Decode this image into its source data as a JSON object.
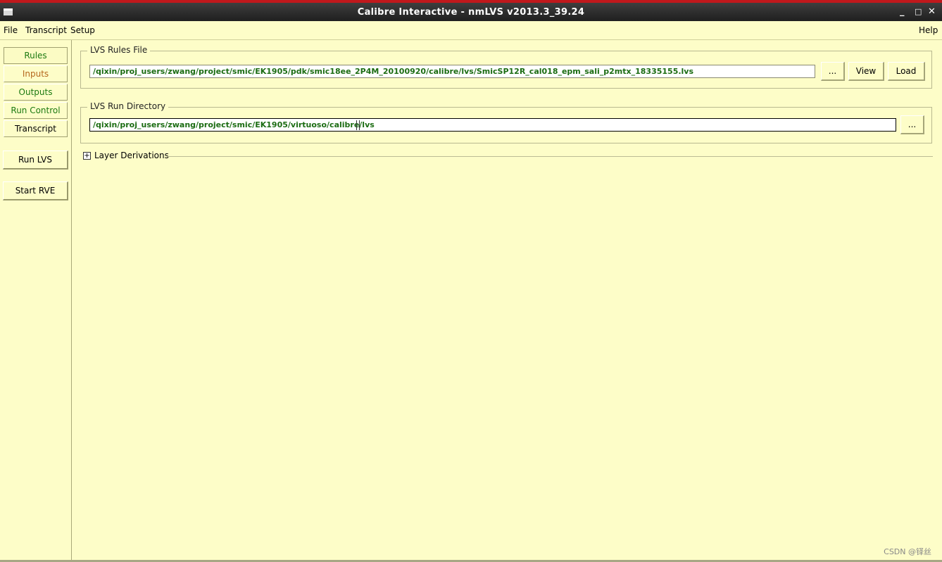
{
  "window": {
    "title": "Calibre Interactive - nmLVS v2013.3_39.24",
    "minimize": "_",
    "maximize": "□",
    "close": "✕"
  },
  "menubar": {
    "file": "File",
    "transcript": "Transcript",
    "setup": "Setup",
    "help": "Help"
  },
  "sidebar": {
    "rules": "Rules",
    "inputs": "Inputs",
    "outputs": "Outputs",
    "run_control": "Run Control",
    "transcript": "Transcript",
    "run_lvs": "Run LVS",
    "start_rve": "Start RVE"
  },
  "rules_file": {
    "title": "LVS Rules File",
    "path": "/qixin/proj_users/zwang/project/smic/EK1905/pdk/smic18ee_2P4M_20100920/calibre/lvs/SmicSP12R_cal018_epm_sali_p2mtx_18335155.lvs",
    "browse": "...",
    "view": "View",
    "load": "Load"
  },
  "run_directory": {
    "title": "LVS Run Directory",
    "path": "/qixin/proj_users/zwang/project/smic/EK1905/virtuoso/calibre/lvs",
    "browse": "..."
  },
  "layer_derivations": {
    "expander": "+",
    "label": "Layer Derivations"
  },
  "watermark": "CSDN @铎丝",
  "colors": {
    "background": "#fdfdc8",
    "titlebar": "#2a2a2a",
    "path_text": "#1b6c12",
    "nav_green": "#1d7a12",
    "nav_orange": "#b5661c"
  }
}
